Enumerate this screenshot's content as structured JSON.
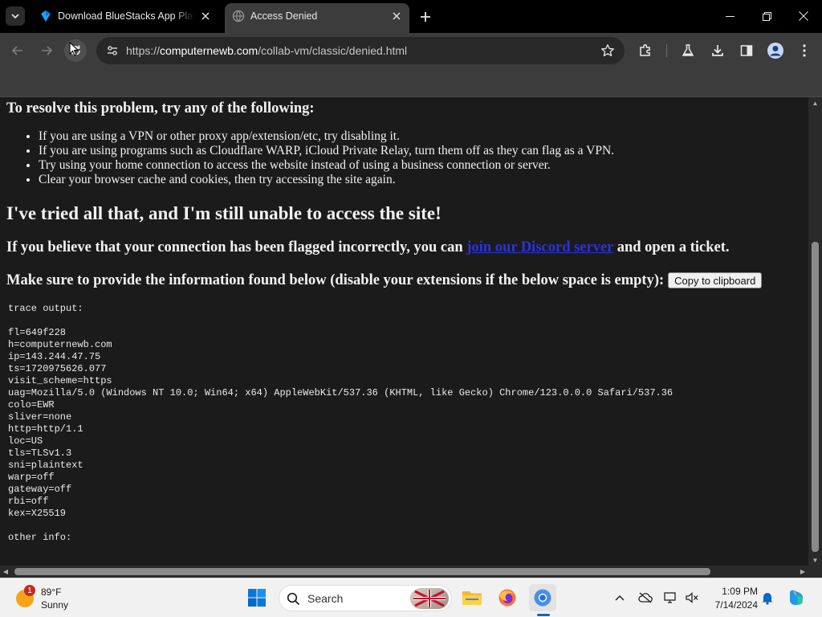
{
  "browser": {
    "tabs": [
      {
        "title": "Download BlueStacks App Player",
        "active": false
      },
      {
        "title": "Access Denied",
        "active": true
      }
    ],
    "url_scheme": "https://",
    "url_host": "computernewb.com",
    "url_path": "/collab-vm/classic/denied.html"
  },
  "page": {
    "resolve_heading": "To resolve this problem, try any of the following:",
    "resolve_items": [
      "If you are using a VPN or other proxy app/extension/etc, try disabling it.",
      "If you are using programs such as Cloudflare WARP, iCloud Private Relay, turn them off as they can flag as a VPN.",
      "Try using your home connection to access the website instead of using a business connection or server.",
      "Clear your browser cache and cookies, then try accessing the site again."
    ],
    "tried_heading": "I've tried all that, and I'm still unable to access the site!",
    "flag_text_before": "If you believe that your connection has been flagged incorrectly, you can",
    "flag_link": "join our Discord server",
    "flag_text_after": "and open a ticket.",
    "make_sure_text": "Make sure to provide the information found below (disable your extensions if the below space is empty):",
    "copy_button": "Copy to clipboard",
    "trace_label": "trace output:",
    "trace_lines": [
      "fl=649f228",
      "h=computernewb.com",
      "ip=143.244.47.75",
      "ts=1720975626.077",
      "visit_scheme=https",
      "uag=Mozilla/5.0 (Windows NT 10.0; Win64; x64) AppleWebKit/537.36 (KHTML, like Gecko) Chrome/123.0.0.0 Safari/537.36",
      "colo=EWR",
      "sliver=none",
      "http=http/1.1",
      "loc=US",
      "tls=TLSv1.3",
      "sni=plaintext",
      "warp=off",
      "gateway=off",
      "rbi=off",
      "kex=X25519"
    ],
    "other_info_label": "other info:"
  },
  "taskbar": {
    "weather_badge": "1",
    "weather_temp": "89°F",
    "weather_desc": "Sunny",
    "search_label": "Search",
    "time": "1:09 PM",
    "date": "7/14/2024"
  },
  "colors": {
    "tab_strip": "#000000",
    "toolbar": "#3c3c3c",
    "page_bg": "#1b1b1b",
    "link": "#2b33d8",
    "taskbar": "#f1f1f1"
  }
}
